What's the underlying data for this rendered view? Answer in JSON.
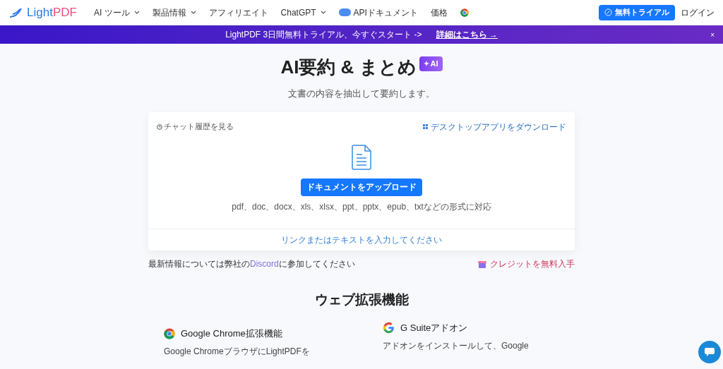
{
  "header": {
    "logo": [
      "Light",
      "PDF"
    ],
    "nav": [
      {
        "label": "AI ツール",
        "caret": true,
        "kind": "text"
      },
      {
        "label": "製品情報",
        "caret": true,
        "kind": "text"
      },
      {
        "label": "アフィリエイト",
        "caret": false,
        "kind": "text"
      },
      {
        "label": "ChatGPT",
        "caret": true,
        "kind": "text"
      },
      {
        "label": "APIドキュメント",
        "caret": false,
        "kind": "api"
      },
      {
        "label": "価格",
        "caret": false,
        "kind": "text"
      }
    ],
    "trial_button": "無料トライアル",
    "login": "ログイン"
  },
  "banner": {
    "text": "LightPDF 3日間無料トライアル、今すぐスタート ->",
    "link": "詳細はこちら →",
    "close": "×"
  },
  "hero": {
    "title": "AI要約 & まとめ",
    "badge": "AI",
    "subtitle": "文書の内容を抽出して要約します。"
  },
  "upload_card": {
    "history_link": "チャット履歴を見る",
    "desktop_link": "デスクトップアプリをダウンロード",
    "upload_button": "ドキュメントをアップロード",
    "formats": "pdf、doc、docx、xls、xlsx、ppt、pptx、epub、txtなどの形式に対応",
    "text_input_link": "リンクまたはテキストを入力してください"
  },
  "notice": {
    "before": "最新情報については弊社の",
    "link": "Discord",
    "after": "に参加してください",
    "credits": "クレジットを無料入手"
  },
  "extensions": {
    "title": "ウェブ拡張機能",
    "items": [
      {
        "kind": "chrome",
        "name": "Google Chrome拡張機能",
        "text": "Google ChromeブラウザにLightPDFを"
      },
      {
        "kind": "google",
        "name": "G Suiteアドオン",
        "text": "アドオンをインストールして、Google"
      }
    ]
  }
}
